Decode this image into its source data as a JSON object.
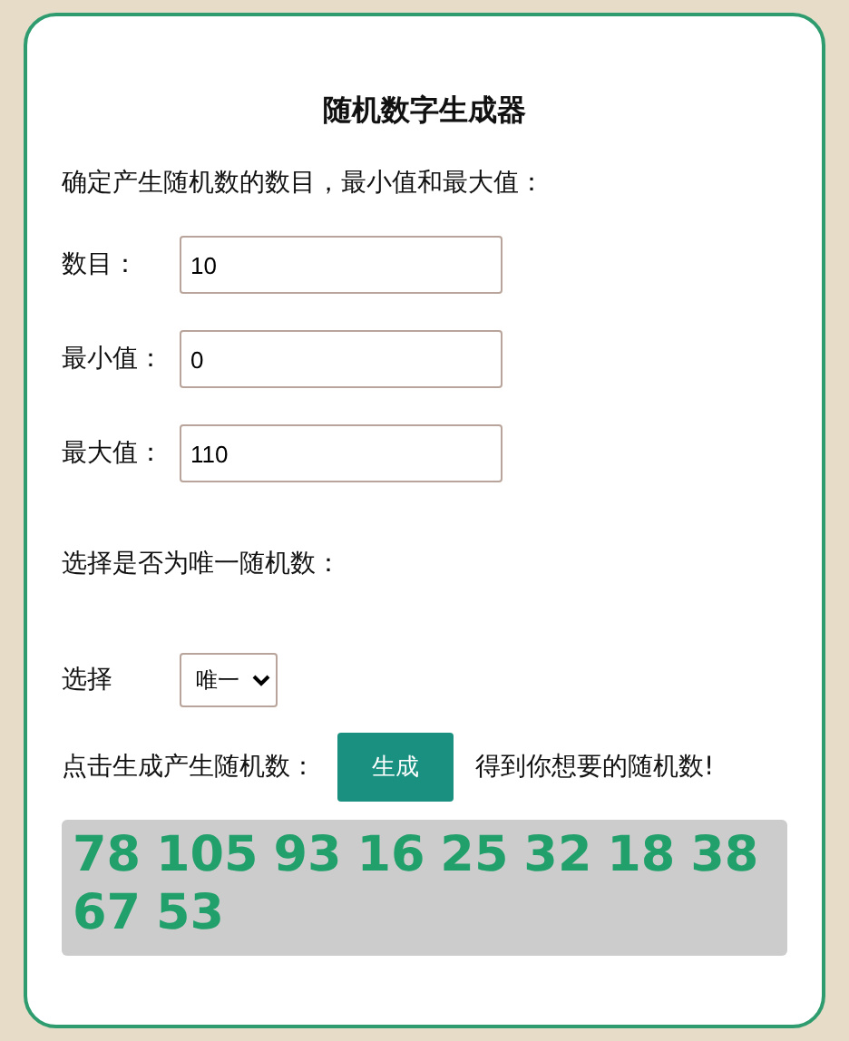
{
  "title": "随机数字生成器",
  "intro": "确定产生随机数的数目，最小值和最大值：",
  "fields": [
    {
      "label": "数目：",
      "value": "10"
    },
    {
      "label": "最小值：",
      "value": "0"
    },
    {
      "label": "最大值：",
      "value": "110"
    }
  ],
  "unique_prompt": "选择是否为唯一随机数：",
  "choice": {
    "label": "选择",
    "value": "唯一"
  },
  "generate": {
    "before": "点击生成产生随机数：",
    "button": "生成",
    "after": "得到你想要的随机数!"
  },
  "result": "78 105 93 16 25 32 18 38 67 53"
}
